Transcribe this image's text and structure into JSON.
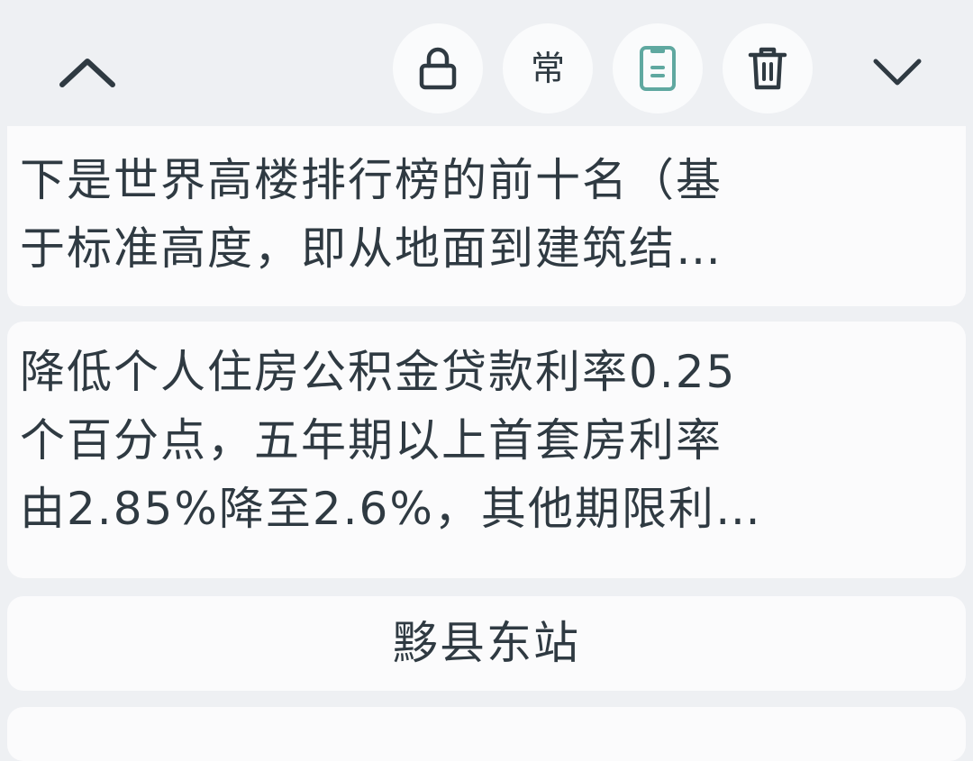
{
  "toolbar": {
    "up_icon": "chevron-up-icon",
    "lock_icon": "lock-icon",
    "common_label": "常",
    "clipboard_icon": "clipboard-icon",
    "delete_icon": "trash-icon",
    "down_icon": "chevron-down-icon",
    "accent_color": "#5fa8a0"
  },
  "clips": [
    {
      "line1": "下是世界高楼排行榜的前十名（基",
      "line2": "于标准高度，即从地面到建筑结…"
    },
    {
      "line1": "降低个人住房公积金贷款利率0.25",
      "line2": "个百分点，五年期以上首套房利率",
      "line3": "由2.85%降至2.6%，其他期限利…"
    },
    {
      "line1": "黟县东站"
    }
  ]
}
